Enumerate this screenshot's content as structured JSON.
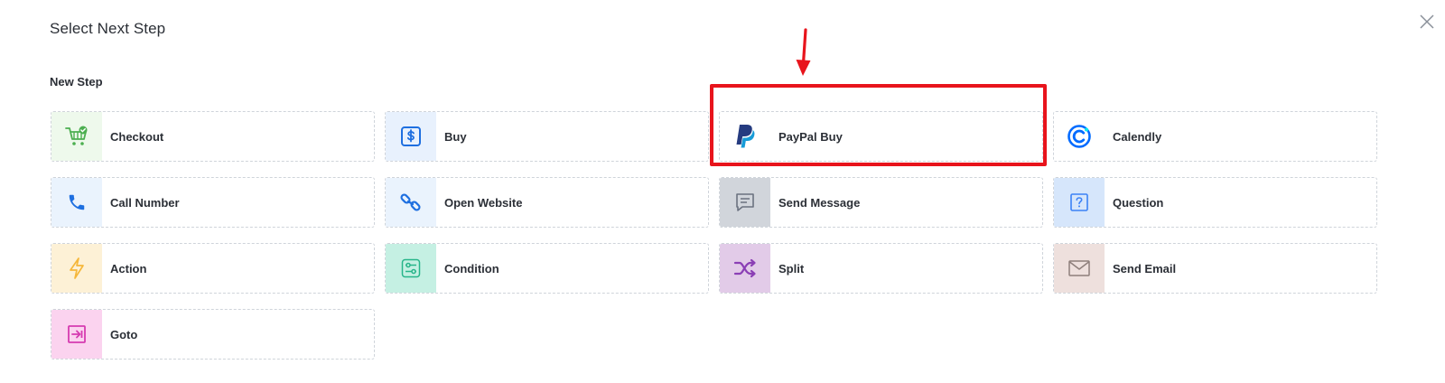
{
  "modal": {
    "title": "Select Next Step",
    "section_label": "New Step"
  },
  "steps": [
    {
      "label": "Checkout",
      "icon": "shopping-cart-check-icon",
      "icon_bg": "#eef9ec",
      "icon_color": "#4caf50"
    },
    {
      "label": "Buy",
      "icon": "dollar-square-icon",
      "icon_bg": "#e8f1fd",
      "icon_color": "#1e6fe0"
    },
    {
      "label": "PayPal Buy",
      "icon": "paypal-logo-icon",
      "icon_bg": "#ffffff",
      "icon_color": "#253b80"
    },
    {
      "label": "Calendly",
      "icon": "calendly-logo-icon",
      "icon_bg": "#ffffff",
      "icon_color": "#006bff"
    },
    {
      "label": "Call Number",
      "icon": "phone-icon",
      "icon_bg": "#eaf3fd",
      "icon_color": "#1e6fe0"
    },
    {
      "label": "Open Website",
      "icon": "link-icon",
      "icon_bg": "#eaf3fd",
      "icon_color": "#1e6fe0"
    },
    {
      "label": "Send Message",
      "icon": "message-icon",
      "icon_bg": "#d1d5db",
      "icon_color": "#6b7280"
    },
    {
      "label": "Question",
      "icon": "question-square-icon",
      "icon_bg": "#d6e6fb",
      "icon_color": "#3b82f6"
    },
    {
      "label": "Action",
      "icon": "lightning-icon",
      "icon_bg": "#fdf1d6",
      "icon_color": "#f5b73b"
    },
    {
      "label": "Condition",
      "icon": "condition-sliders-icon",
      "icon_bg": "#c5f0e3",
      "icon_color": "#27b58a"
    },
    {
      "label": "Split",
      "icon": "shuffle-icon",
      "icon_bg": "#e2cbe8",
      "icon_color": "#8b3fb5"
    },
    {
      "label": "Send Email",
      "icon": "envelope-icon",
      "icon_bg": "#eee0dd",
      "icon_color": "#8e7f7b"
    },
    {
      "label": "Goto",
      "icon": "goto-arrow-icon",
      "icon_bg": "#fbd3ef",
      "icon_color": "#d63bb0"
    }
  ],
  "annotation": {
    "highlight_color": "#e8141c"
  }
}
